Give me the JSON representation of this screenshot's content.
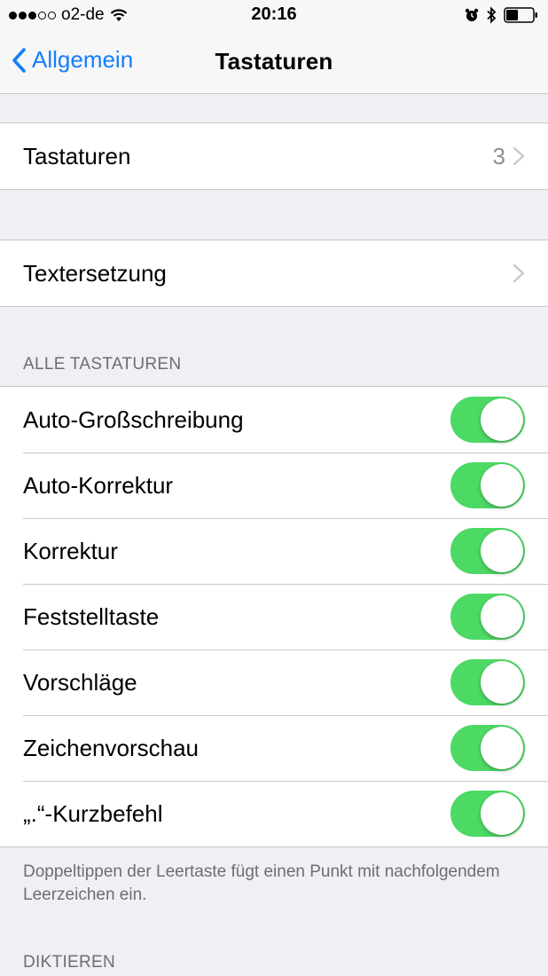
{
  "status_bar": {
    "carrier": "o2-de",
    "time": "20:16",
    "signal_dots_full": 3,
    "signal_dots_empty": 2,
    "icons": [
      "wifi-icon",
      "alarm-icon",
      "bluetooth-icon",
      "battery-icon"
    ],
    "battery_level": 0.45
  },
  "nav": {
    "back_label": "Allgemein",
    "title": "Tastaturen"
  },
  "group1": {
    "label": "Tastaturen",
    "value": "3"
  },
  "group2": {
    "label": "Textersetzung"
  },
  "section_all": {
    "header": "ALLE TASTATUREN",
    "items": [
      {
        "label": "Auto-Großschreibung",
        "on": true
      },
      {
        "label": "Auto-Korrektur",
        "on": true
      },
      {
        "label": "Korrektur",
        "on": true
      },
      {
        "label": "Feststelltaste",
        "on": true
      },
      {
        "label": "Vorschläge",
        "on": true
      },
      {
        "label": "Zeichenvorschau",
        "on": true
      },
      {
        "label": "„.“-Kurzbefehl",
        "on": true
      }
    ],
    "footer": "Doppeltippen der Leertaste fügt einen Punkt mit nachfolgendem Leerzeichen ein."
  },
  "section_dictation": {
    "header": "DIKTIEREN"
  },
  "colors": {
    "accent": "#157efb",
    "toggle_on": "#4cd964",
    "background": "#efeff4",
    "secondary_text": "#6d6d72"
  }
}
